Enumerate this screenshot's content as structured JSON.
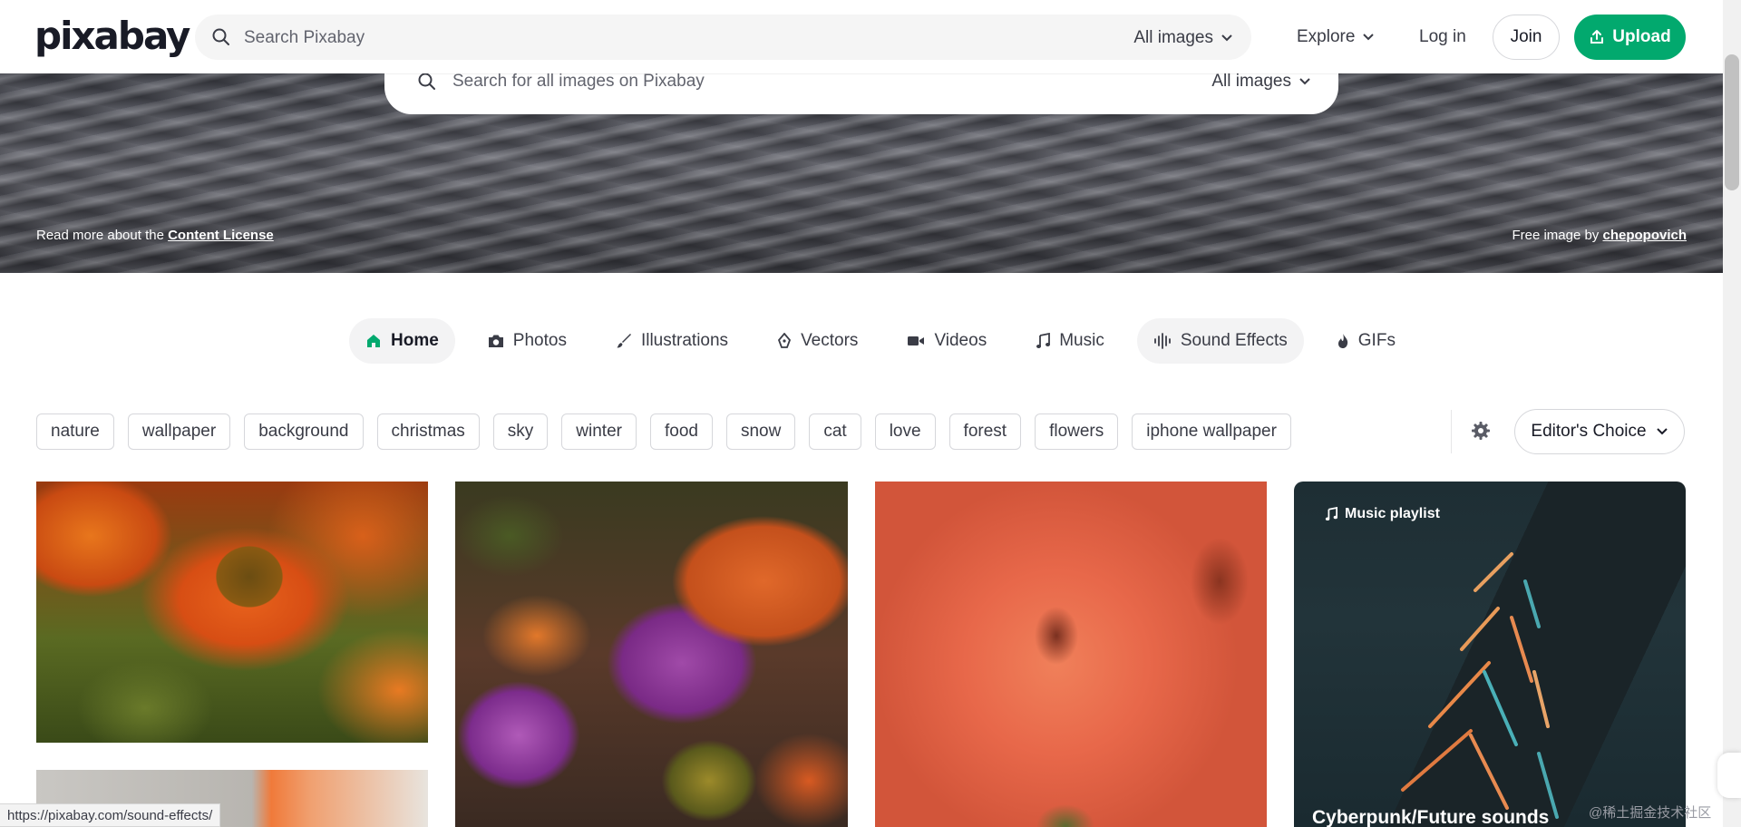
{
  "header": {
    "logo": "pixabay",
    "search_placeholder": "Search Pixabay",
    "search_filter": "All images",
    "explore": "Explore",
    "login": "Log in",
    "join": "Join",
    "upload": "Upload"
  },
  "hero": {
    "search_placeholder": "Search for all images on Pixabay",
    "search_filter": "All images",
    "license_prefix": "Read more about the ",
    "license_link": "Content License",
    "credit_prefix": "Free image by ",
    "credit_author": "chepopovich"
  },
  "categories": [
    {
      "label": "Home",
      "icon": "home-icon"
    },
    {
      "label": "Photos",
      "icon": "camera-icon"
    },
    {
      "label": "Illustrations",
      "icon": "brush-icon"
    },
    {
      "label": "Vectors",
      "icon": "pen-icon"
    },
    {
      "label": "Videos",
      "icon": "video-icon"
    },
    {
      "label": "Music",
      "icon": "music-note-icon"
    },
    {
      "label": "Sound Effects",
      "icon": "waveform-icon"
    },
    {
      "label": "GIFs",
      "icon": "flame-icon"
    }
  ],
  "tags": [
    "nature",
    "wallpaper",
    "background",
    "christmas",
    "sky",
    "winter",
    "food",
    "snow",
    "cat",
    "love",
    "forest",
    "flowers",
    "iphone wallpaper"
  ],
  "sort": {
    "label": "Editor's Choice"
  },
  "playlist": {
    "badge": "Music playlist",
    "title": "Cyberpunk/Future sounds"
  },
  "status": {
    "url": "https://pixabay.com/sound-effects/"
  },
  "watermark": "@稀土掘金技术社区",
  "colors": {
    "brand": "#02a96e",
    "text": "#191b26"
  }
}
